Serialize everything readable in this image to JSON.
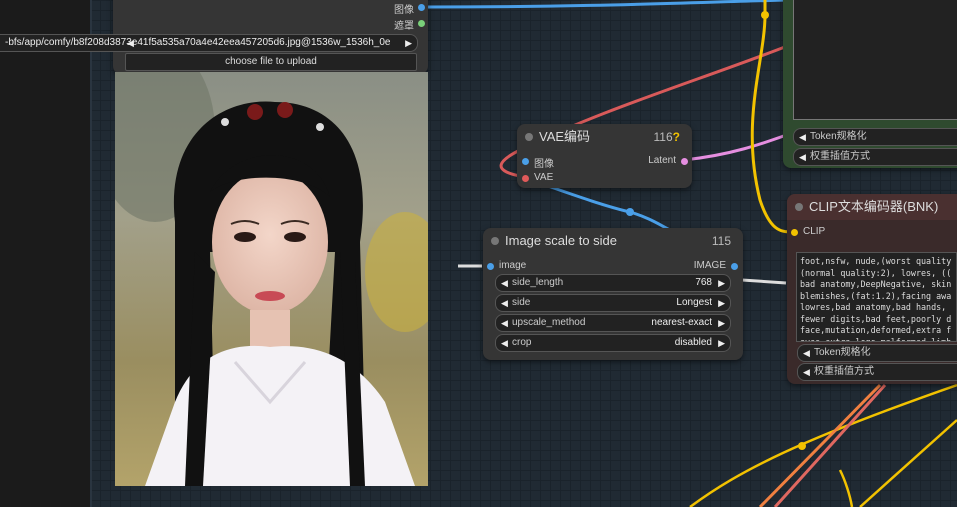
{
  "load_image_node": {
    "output_image_label": "图像",
    "output_mask_label": "遮罩",
    "image_path": "-bfs/app/comfy/b8f208d3873e41f5a535a70a4e42eea457205d6.jpg@1536w_1536h_0e",
    "upload_button": "choose file to upload"
  },
  "vae_node": {
    "title": "VAE编码",
    "id": "116",
    "warning": "?",
    "input_image": "图像",
    "input_vae": "VAE",
    "output_latent": "Latent"
  },
  "scale_node": {
    "title": "Image scale to side",
    "id": "115",
    "input_image": "image",
    "output_image": "IMAGE",
    "widgets": [
      {
        "label": "side_length",
        "value": "768"
      },
      {
        "label": "side",
        "value": "Longest"
      },
      {
        "label": "upscale_method",
        "value": "nearest-exact"
      },
      {
        "label": "crop",
        "value": "disabled"
      }
    ]
  },
  "top_right_node": {
    "token_normalization": "Token规格化",
    "weight_interpretation": "权重插值方式"
  },
  "clip_node": {
    "title": "CLIP文本编码器(BNK)",
    "input_clip": "CLIP",
    "text": "foot,nsfw, nude,(worst quality\n(normal quality:2), lowres, ((\nbad anatomy,DeepNegative, skin\nblemishes,(fat:1.2),facing awa\nlowres,bad anatomy,bad hands, \nfewer digits,bad feet,poorly d\nface,mutation,deformed,extra f\neyes,extra legs,malformed limb",
    "token_normalization": "Token规格化",
    "weight_interpretation": "权重插值方式"
  },
  "colors": {
    "canvas": "#202a33",
    "node_bg": "#353535",
    "clip_node_bg": "#3a2a2a",
    "green_node_bg": "#2f4a2f",
    "wire_image": "#4a9fe8",
    "wire_vae": "#e05a5a",
    "wire_latent": "#e58ee0",
    "wire_clip": "#f2c200",
    "wire_orange": "#f08040"
  }
}
